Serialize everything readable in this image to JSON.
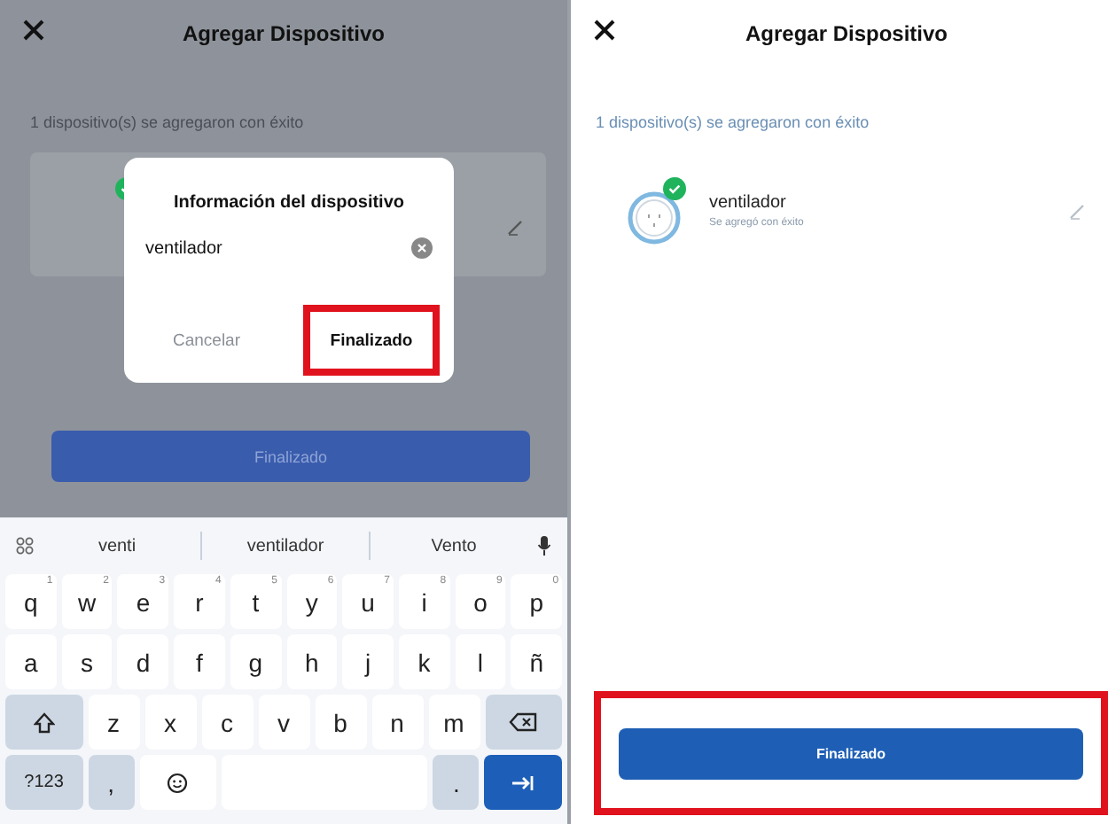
{
  "left_screen": {
    "header": {
      "title": "Agregar Dispositivo"
    },
    "message": "1 dispositivo(s) se agregaron con éxito",
    "dialog": {
      "title": "Información del dispositivo",
      "input": {
        "value": "ventilador"
      },
      "buttons": [
        {
          "label": "Cancelar",
          "kind": "cancel",
          "highlighted": false
        },
        {
          "label": "Finalizado",
          "kind": "confirm",
          "highlighted": true
        }
      ]
    },
    "finish_button": {
      "label": "Finalizado",
      "highlighted": false
    },
    "keyboard": {
      "suggestions": [
        "venti",
        "ventilador",
        "Vento"
      ],
      "rows": [
        [
          {
            "kind": "letter",
            "label": "q",
            "hint": "1"
          },
          {
            "kind": "letter",
            "label": "w",
            "hint": "2"
          },
          {
            "kind": "letter",
            "label": "e",
            "hint": "3"
          },
          {
            "kind": "letter",
            "label": "r",
            "hint": "4"
          },
          {
            "kind": "letter",
            "label": "t",
            "hint": "5"
          },
          {
            "kind": "letter",
            "label": "y",
            "hint": "6"
          },
          {
            "kind": "letter",
            "label": "u",
            "hint": "7"
          },
          {
            "kind": "letter",
            "label": "i",
            "hint": "8"
          },
          {
            "kind": "letter",
            "label": "o",
            "hint": "9"
          },
          {
            "kind": "letter",
            "label": "p",
            "hint": "0"
          }
        ],
        [
          {
            "kind": "letter",
            "label": "a"
          },
          {
            "kind": "letter",
            "label": "s"
          },
          {
            "kind": "letter",
            "label": "d"
          },
          {
            "kind": "letter",
            "label": "f"
          },
          {
            "kind": "letter",
            "label": "g"
          },
          {
            "kind": "letter",
            "label": "h"
          },
          {
            "kind": "letter",
            "label": "j"
          },
          {
            "kind": "letter",
            "label": "k"
          },
          {
            "kind": "letter",
            "label": "l"
          },
          {
            "kind": "letter",
            "label": "ñ"
          }
        ],
        [
          {
            "kind": "shift"
          },
          {
            "kind": "letter",
            "label": "z"
          },
          {
            "kind": "letter",
            "label": "x"
          },
          {
            "kind": "letter",
            "label": "c"
          },
          {
            "kind": "letter",
            "label": "v"
          },
          {
            "kind": "letter",
            "label": "b"
          },
          {
            "kind": "letter",
            "label": "n"
          },
          {
            "kind": "letter",
            "label": "m"
          },
          {
            "kind": "backspace"
          }
        ],
        [
          {
            "kind": "symbols",
            "label": "?123"
          },
          {
            "kind": "punct",
            "label": ","
          },
          {
            "kind": "emoji"
          },
          {
            "kind": "space"
          },
          {
            "kind": "punct",
            "label": "."
          },
          {
            "kind": "enter"
          }
        ]
      ]
    }
  },
  "right_screen": {
    "header": {
      "title": "Agregar Dispositivo"
    },
    "message": "1 dispositivo(s) se agregaron con éxito",
    "device": {
      "name": "ventilador",
      "status": "Se agregó con éxito"
    },
    "finish_button": {
      "label": "Finalizado",
      "highlighted": true
    }
  }
}
